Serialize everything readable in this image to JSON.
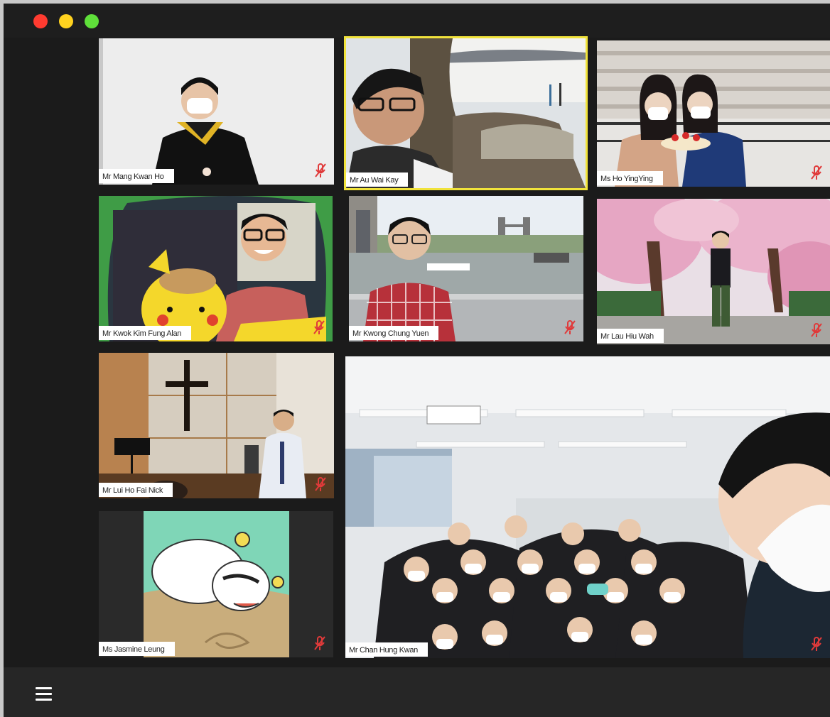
{
  "window": {
    "traffic_lights": {
      "close_color": "#ff3b30",
      "minimize_color": "#ffd21f",
      "zoom_color": "#5fe03a"
    }
  },
  "participants": [
    {
      "name": "Mr Mang Kwan Ho",
      "mic": "muted"
    },
    {
      "name": "Mr Au Wai Kay",
      "mic": "active-speaker"
    },
    {
      "name": "Ms Ho YingYing",
      "mic": "muted"
    },
    {
      "name": "Mr Kwok Kim Fung Alan",
      "mic": "muted"
    },
    {
      "name": "Mr Kwong Chung Yuen",
      "mic": "muted"
    },
    {
      "name": "Mr Lau Hiu Wah",
      "mic": "muted"
    },
    {
      "name": "Mr Lui Ho Fai Nick",
      "mic": "muted"
    },
    {
      "name": "Ms Jasmine Leung",
      "mic": "muted"
    },
    {
      "name": "Mr Chan Hung Kwan",
      "mic": "muted"
    }
  ],
  "colors": {
    "active_speaker_border": "#f1e33b",
    "mute_icon": "#e03a3a"
  },
  "toolbar": {
    "menu_icon": "hamburger-menu-icon"
  }
}
